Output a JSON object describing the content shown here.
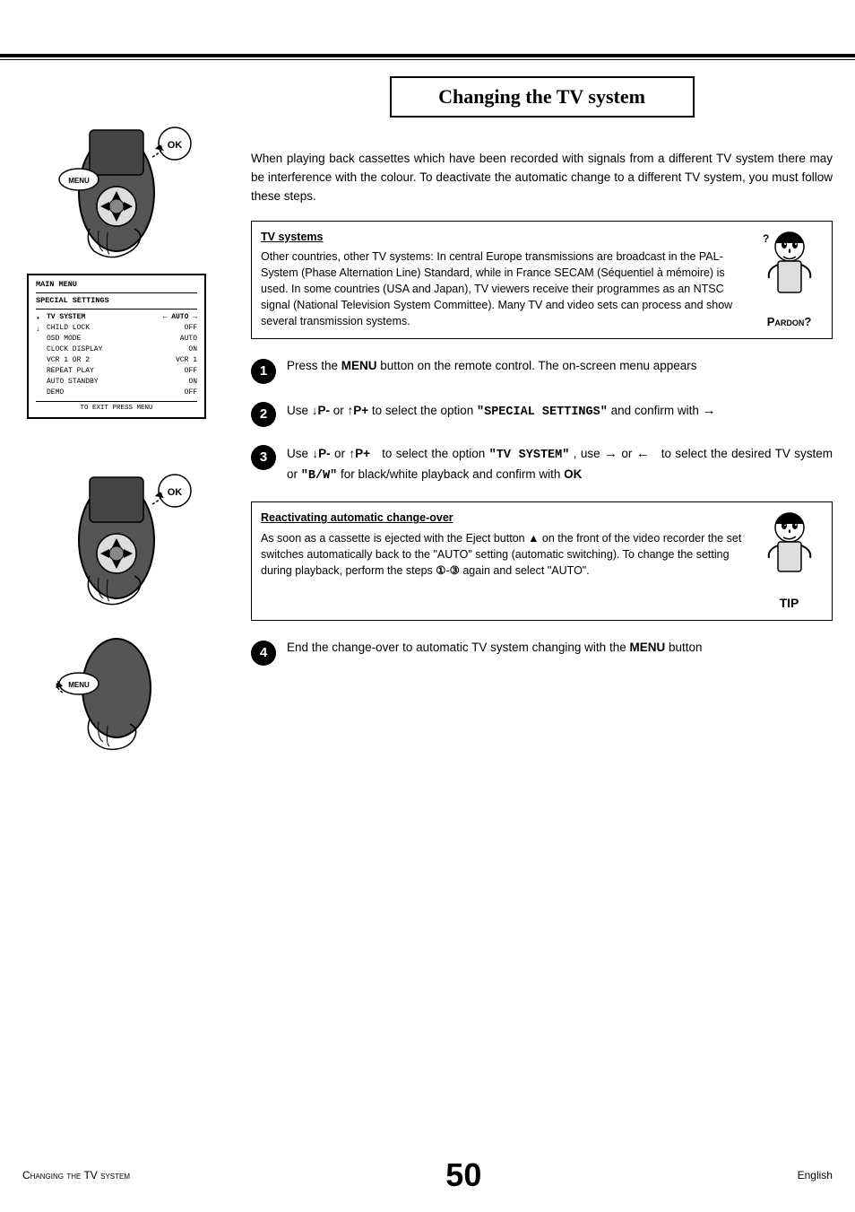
{
  "page": {
    "title": "Changing the TV system",
    "top_lines": true
  },
  "intro": {
    "text": "When playing back cassettes which have been recorded with signals from a different TV system there may be interference with the colour. To deactivate the automatic change to a different TV system, you must follow these steps."
  },
  "tv_systems_box": {
    "title": "TV systems",
    "text": "Other countries, other TV systems: In central Europe transmissions are broadcast in the PAL-System (Phase Alternation Line) Standard, while in France SECAM (Séquentiel à mémoire) is used. In some countries (USA and Japan), TV viewers receive their programmes as an NTSC signal (National Television System Committee). Many TV and video sets can process and show several transmission systems.",
    "pardon_label": "Pardon?"
  },
  "steps": [
    {
      "number": "1",
      "text": "Press the MENU button on the remote control. The on-screen menu appears"
    },
    {
      "number": "2",
      "text": "Use ↓P- or ↑P+ to select the option \"SPECIAL SETTINGS\" and confirm with →"
    },
    {
      "number": "3",
      "text": "Use ↓P- or ↑P+ to select the option \"TV SYSTEM\" , use → or ← to select the desired TV system or \"B/W\" for black/white playback and confirm with OK"
    },
    {
      "number": "4",
      "text": "End the change-over to automatic TV system changing with the MENU button"
    }
  ],
  "tip_box": {
    "title": "Reactivating automatic change-over",
    "text": "As soon as a cassette is ejected with the Eject button ▲ on the front of the video recorder the set switches automatically back to the \"AUTO\" setting (automatic switching). To change the setting during playback, perform the steps 1-3 again and select \"AUTO\".",
    "tip_label": "TIP"
  },
  "menu_screen": {
    "title1": "MAIN MENU",
    "title2": "SPECIAL SETTINGS",
    "rows": [
      {
        "label": "TV SYSTEM",
        "value": "← AUTO →",
        "selected": true
      },
      {
        "label": "CHILD LOCK",
        "value": "OFF"
      },
      {
        "label": "OSD MODE",
        "value": "AUTO"
      },
      {
        "label": "CLOCK DISPLAY",
        "value": "ON"
      },
      {
        "label": "VCR 1 OR 2",
        "value": "VCR 1"
      },
      {
        "label": "REPEAT PLAY",
        "value": "OFF"
      },
      {
        "label": "AUTO STANDBY",
        "value": "ON"
      },
      {
        "label": "DEMO",
        "value": "OFF"
      }
    ],
    "footer": "TO EXIT PRESS MENU"
  },
  "footer": {
    "left": "Changing the TV system",
    "center": "50",
    "right": "English"
  }
}
